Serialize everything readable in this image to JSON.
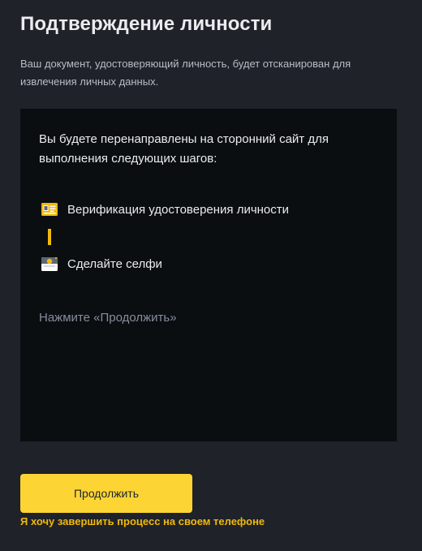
{
  "header": {
    "title": "Подтверждение личности",
    "subtitle": "Ваш документ, удостоверяющий личность, будет отсканирован для извлечения личных данных."
  },
  "panel": {
    "intro": "Вы будете перенаправлены на сторонний сайт для выполнения следующих шагов:",
    "steps": [
      {
        "label": "Верификация удостоверения личности",
        "icon": "id-card-icon"
      },
      {
        "label": "Сделайте селфи",
        "icon": "selfie-icon"
      }
    ],
    "hint": "Нажмите «Продолжить»"
  },
  "actions": {
    "continue_label": "Продолжить",
    "phone_link_label": "Я хочу завершить процесс на своем телефоне"
  },
  "colors": {
    "background": "#1f2229",
    "panel": "#0b0e11",
    "accent": "#fcd535",
    "link": "#f0b90b",
    "text_primary": "#eaecef",
    "text_secondary": "#b7bdc6",
    "text_muted": "#848e9c"
  }
}
